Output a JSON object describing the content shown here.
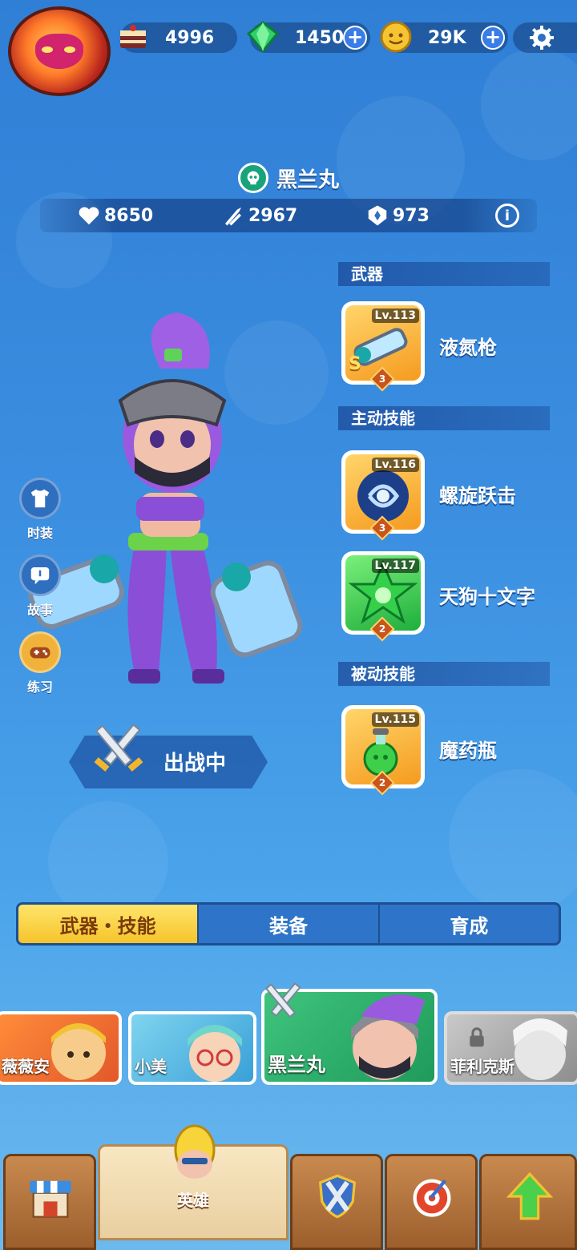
{
  "resources": {
    "cake": "4996",
    "gems": "1450",
    "coins": "29K"
  },
  "hero": {
    "name": "黑兰丸",
    "hp": "8650",
    "attack": "2967",
    "defense": "973"
  },
  "sections": {
    "weapon": "武器",
    "active": "主动技能",
    "passive": "被动技能"
  },
  "skills": [
    {
      "level": "Lv.113",
      "name": "液氮枪",
      "stars": "3",
      "grade": "S"
    },
    {
      "level": "Lv.116",
      "name": "螺旋跃击",
      "stars": "3"
    },
    {
      "level": "Lv.117",
      "name": "天狗十文字",
      "stars": "2"
    },
    {
      "level": "Lv.115",
      "name": "魔药瓶",
      "stars": "2"
    }
  ],
  "side_buttons": {
    "costume": "时装",
    "story": "故事",
    "practice": "练习"
  },
  "battle_button": "出战中",
  "tabs": [
    "武器・技能",
    "装备",
    "育成"
  ],
  "hero_list": [
    "薇薇安",
    "小美",
    "黑兰丸",
    "菲利克斯"
  ],
  "nav": {
    "hero": "英雄"
  },
  "colors": {
    "accent_yellow": "#f5c42b",
    "panel_blue": "#2e74c8",
    "wood": "#9c5f2d"
  }
}
